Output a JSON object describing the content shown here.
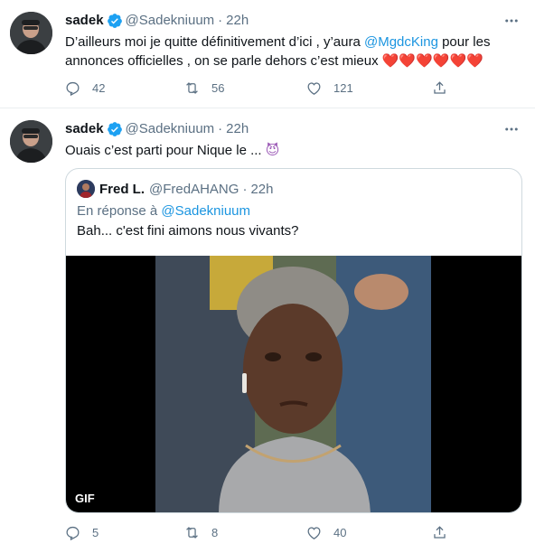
{
  "tweets": [
    {
      "name": "sadek",
      "handle": "@Sadekniuum",
      "dot": "·",
      "time": "22h",
      "text_before": "D’ailleurs moi je quitte définitivement d’ici , y’aura ",
      "mention": "@MgdcKing",
      "text_after": " pour les annonces officielles , on se parle dehors c’est mieux ",
      "emoji": "❤️❤️❤️❤️❤️❤️",
      "replies": "42",
      "retweets": "56",
      "likes": "121"
    },
    {
      "name": "sadek",
      "handle": "@Sadekniuum",
      "dot": "·",
      "time": "22h",
      "text": "Ouais c’est parti pour Nique le ... ",
      "emoji": "😈",
      "replies": "5",
      "retweets": "8",
      "likes": "40",
      "quote": {
        "name": "Fred L.",
        "handle": "@FredAHANG",
        "dot": "·",
        "time": "22h",
        "reply_prefix": "En réponse à ",
        "reply_to": "@Sadekniuum",
        "text": "Bah... c'est fini aimons nous vivants?",
        "media_badge": "GIF"
      }
    }
  ],
  "icons": [
    "verified-icon",
    "more-icon",
    "reply-icon",
    "retweet-icon",
    "like-icon",
    "share-icon"
  ],
  "colors": {
    "accent": "#1b95e0",
    "secondary": "#5b7083",
    "border": "#ebeef0",
    "heart": "#e0245e"
  }
}
